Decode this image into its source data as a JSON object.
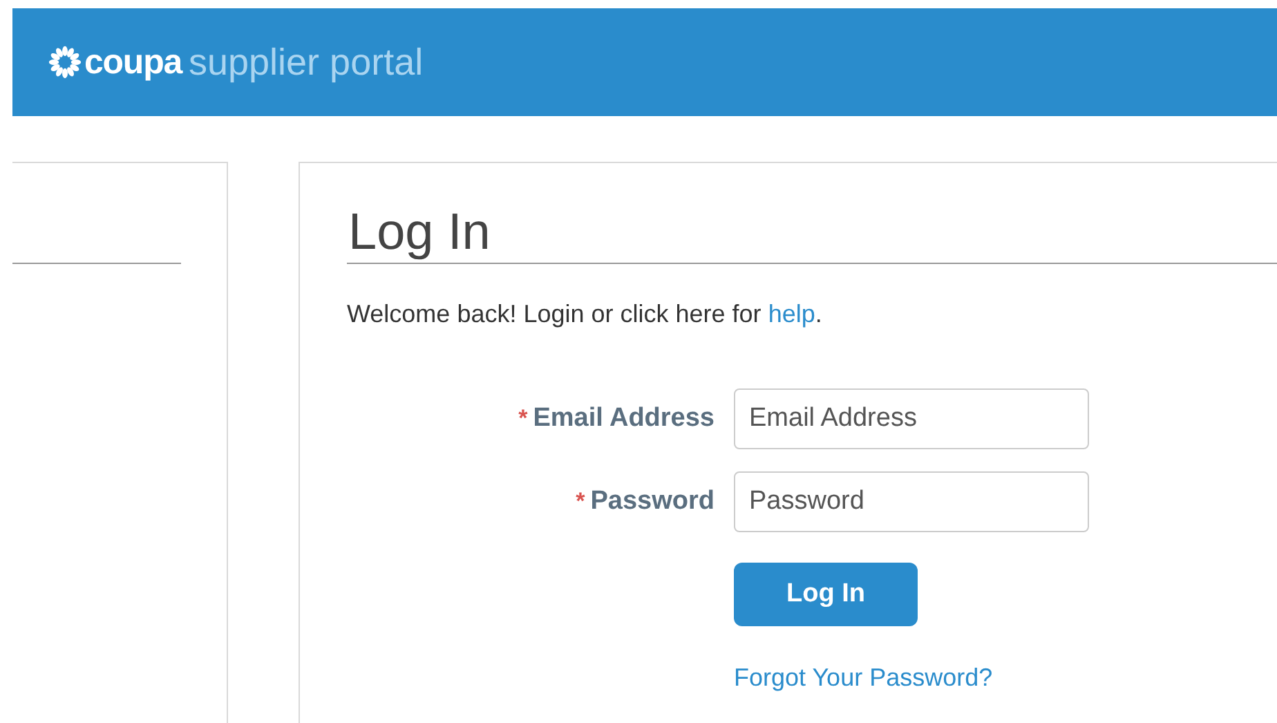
{
  "header": {
    "brand": "coupa",
    "product": "supplier portal"
  },
  "login": {
    "title": "Log In",
    "welcome": "Welcome back! Login or click here for",
    "help_link": "help",
    "help_end": ".",
    "fields": [
      {
        "label": "Email Address",
        "required_mark": "*",
        "placeholder": "Email Address"
      },
      {
        "label": "Password",
        "required_mark": "*",
        "placeholder": "Password"
      }
    ],
    "submit": "Log In",
    "forgot_link": "Forgot Your Password?"
  }
}
